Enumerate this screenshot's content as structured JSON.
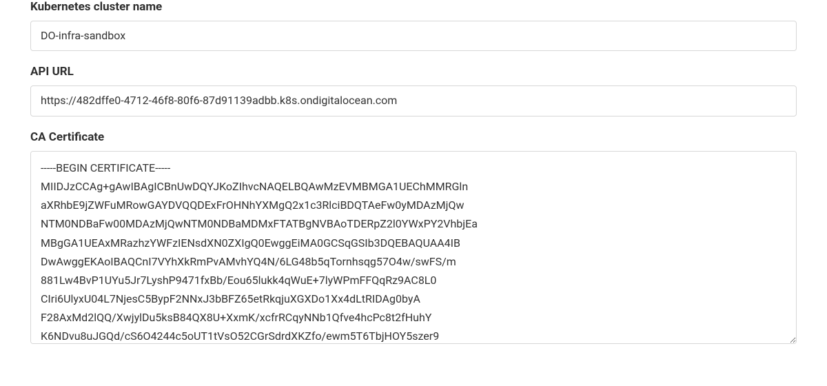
{
  "form": {
    "clusterName": {
      "label": "Kubernetes cluster name",
      "value": "DO-infra-sandbox"
    },
    "apiUrl": {
      "label": "API URL",
      "value": "https://482dffe0-4712-46f8-80f6-87d91139adbb.k8s.ondigitalocean.com"
    },
    "caCertificate": {
      "label": "CA Certificate",
      "value": "-----BEGIN CERTIFICATE-----\nMIIDJzCCAg+gAwIBAgICBnUwDQYJKoZIhvcNAQELBQAwMzEVMBMGA1UEChMMRGln\naXRhbE9jZWFuMRowGAYDVQQDExFrOHNhYXMgQ2x1c3RlciBDQTAeFw0yMDAzMjQw\nNTM0NDBaFw00MDAzMjQwNTM0NDBaMDMxFTATBgNVBAoTDERpZ2l0YWxPY2VhbjEa\nMBgGA1UEAxMRazhzYWFzIENsdXN0ZXIgQ0EwggEiMA0GCSqGSIb3DQEBAQUAA4IB\nDwAwggEKAoIBAQCnI7VYhXkRmPvAMvhYQ4N/6LG48b5qTornhsqg57O4w/swFS/m\n881Lw4BvP1UYu5Jr7LyshP9471fxBb/Eou65lukk4qWuE+7lyWPmFFQqRz9AC8L0\nCIri6UlyxU04L7NjesC5BypF2NNxJ3bBFZ65etRkqjuXGXDo1Xx4dLtRIDAg0byA\nF28AxMd2lQQ/XwjylDu5ksB84QX8U+XxmK/xcfrRCqyNNb1Qfve4hcPc8t2fHuhY\nK6NDvu8uJGQd/cS6O4244c5oUT1tVsO52CGrSdrdXKZfo/ewm5T6TbjHOY5szer9"
    }
  }
}
